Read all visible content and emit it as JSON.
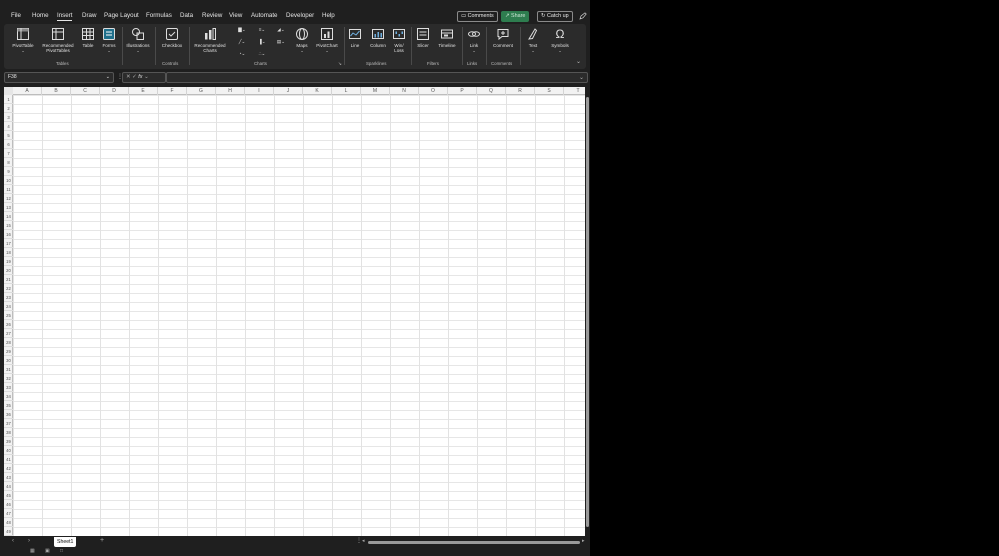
{
  "menu": {
    "tabs": [
      "File",
      "Home",
      "Insert",
      "Draw",
      "Page Layout",
      "Formulas",
      "Data",
      "Review",
      "View",
      "Automate",
      "Developer",
      "Help"
    ],
    "active_tab": "Insert",
    "comments_label": "Comments",
    "share_label": "Share",
    "catchup_label": "Catch up"
  },
  "ribbon": {
    "pivottable": "PivotTable",
    "recommended_pivottables_1": "Recommended",
    "recommended_pivottables_2": "PivotTables",
    "table": "Table",
    "forms": "Forms",
    "illustrations": "Illustrations",
    "checkbox": "Checkbox",
    "recommended_charts_1": "Recommended",
    "recommended_charts_2": "Charts",
    "maps": "Maps",
    "pivotchart": "PivotChart",
    "line": "Line",
    "column": "Column",
    "winloss_1": "Win/",
    "winloss_2": "Loss",
    "slicer": "Slicer",
    "timeline": "Timeline",
    "link": "Link",
    "comment": "Comment",
    "text": "Text",
    "symbols": "Symbols",
    "groups": {
      "tables": "Tables",
      "controls": "Controls",
      "charts": "Charts",
      "sparklines": "Sparklines",
      "filters": "Filters",
      "links": "Links",
      "comments": "Comments"
    }
  },
  "formula_bar": {
    "name_box": "F38",
    "fx": "fx",
    "value": ""
  },
  "sheet": {
    "columns": [
      "A",
      "B",
      "C",
      "D",
      "E",
      "F",
      "G",
      "H",
      "I",
      "J",
      "K",
      "L",
      "M",
      "N",
      "O",
      "P",
      "Q",
      "R",
      "S",
      "T"
    ],
    "rows": [
      "1",
      "2",
      "3",
      "4",
      "5",
      "6",
      "7",
      "8",
      "9",
      "10",
      "11",
      "12",
      "13",
      "14",
      "15",
      "16",
      "17",
      "18",
      "19",
      "20",
      "21",
      "22",
      "23",
      "24",
      "25",
      "26",
      "27",
      "28",
      "29",
      "30",
      "31",
      "32",
      "33",
      "34",
      "35",
      "36",
      "37",
      "38",
      "39",
      "40",
      "41",
      "42",
      "43",
      "44",
      "45",
      "46",
      "47",
      "48",
      "49"
    ]
  },
  "tabs": {
    "sheet1": "Sheet1"
  },
  "colors": {
    "share_green": "#2e7d4f",
    "ribbon_bg": "#2b2b2b",
    "app_bg": "#1f1f1f"
  }
}
